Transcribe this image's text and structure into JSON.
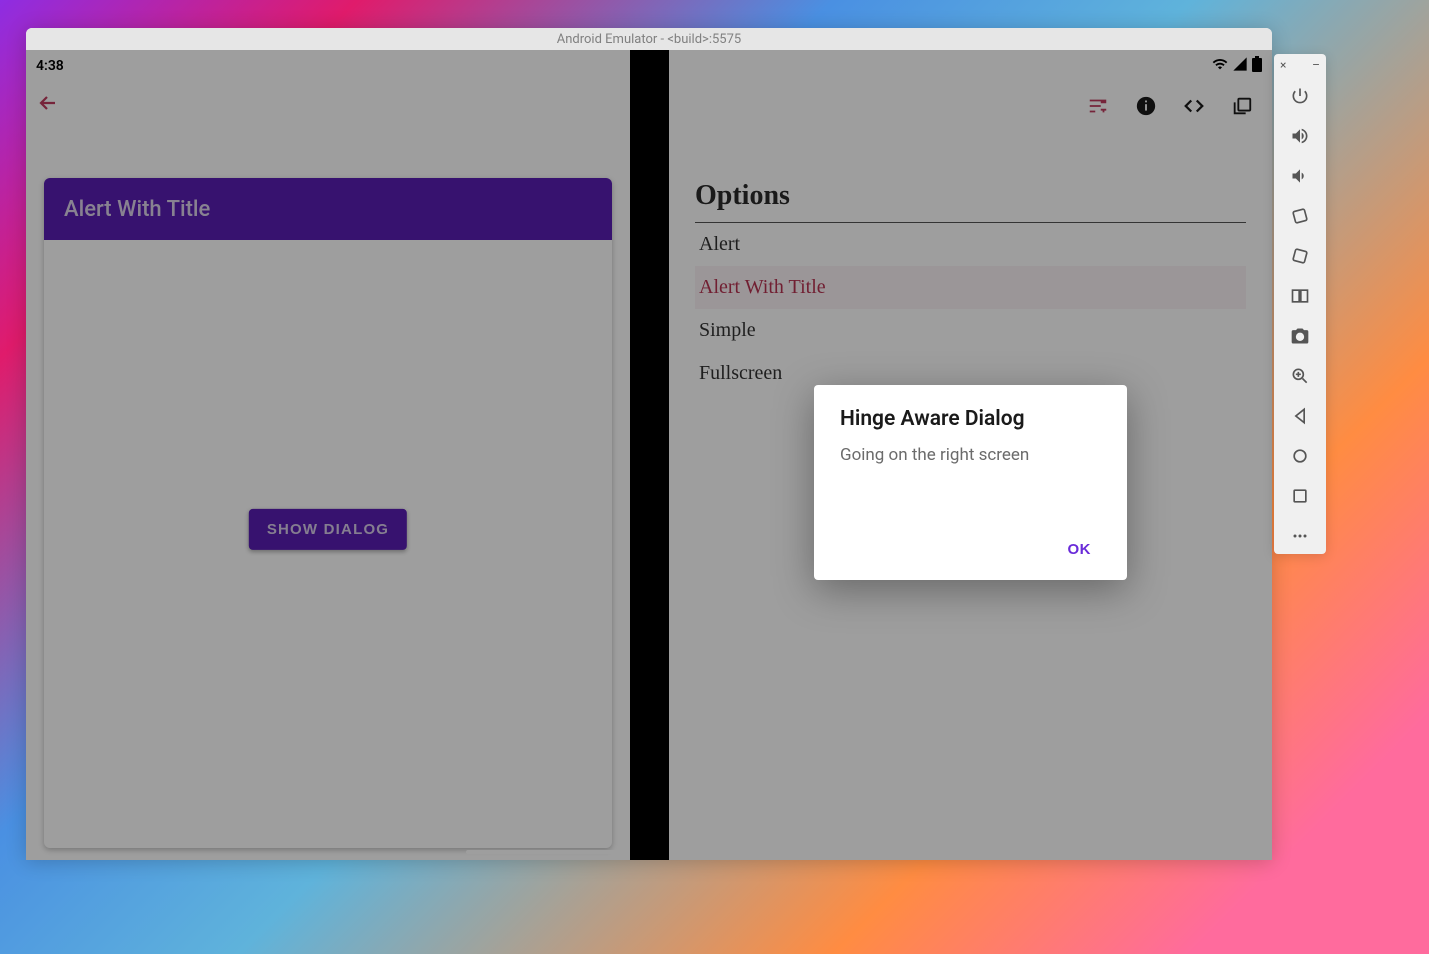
{
  "emulator": {
    "title": "Android Emulator - <build>:5575"
  },
  "statusbar": {
    "time": "4:38"
  },
  "leftPane": {
    "appbar_title": "Alert With Title",
    "show_dialog_label": "SHOW DIALOG"
  },
  "rightPane": {
    "options_heading": "Options",
    "items": [
      {
        "label": "Alert",
        "selected": false
      },
      {
        "label": "Alert With Title",
        "selected": true
      },
      {
        "label": "Simple",
        "selected": false
      },
      {
        "label": "Fullscreen",
        "selected": false
      }
    ]
  },
  "dialog": {
    "title": "Hinge Aware Dialog",
    "body": "Going on the right screen",
    "ok_label": "OK"
  },
  "colors": {
    "primary": "#5a1eb3",
    "accent": "#bf3b5e",
    "dialog_action": "#6a2bd9"
  },
  "sidebar": {
    "close": "×",
    "minimize": "–"
  }
}
